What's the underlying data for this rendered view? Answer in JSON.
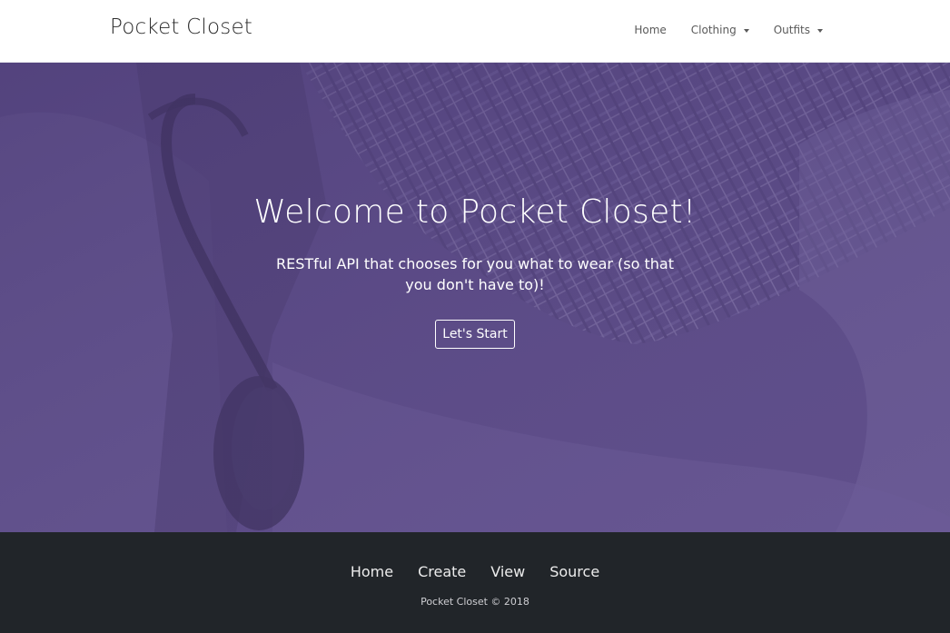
{
  "navbar": {
    "brand": "Pocket Closet",
    "links": [
      {
        "label": "Home"
      },
      {
        "label": "Clothing"
      },
      {
        "label": "Outfits"
      }
    ]
  },
  "hero": {
    "title": "Welcome to Pocket Closet!",
    "subtitle": "RESTful API that chooses for you what to wear (so that you don't have to)!",
    "button_label": "Let's Start",
    "overlay_color": "#5b4a86"
  },
  "footer": {
    "links": [
      {
        "label": "Home"
      },
      {
        "label": "Create"
      },
      {
        "label": "View"
      },
      {
        "label": "Source"
      }
    ],
    "copyright": "Pocket Closet © 2018",
    "background_color": "#212529"
  }
}
